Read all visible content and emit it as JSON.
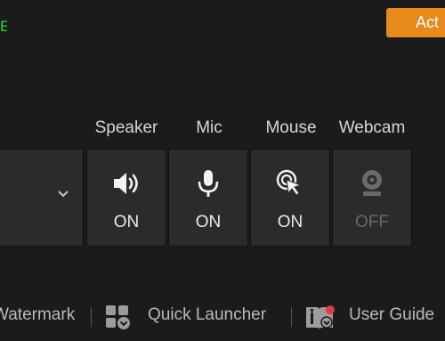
{
  "header": {
    "status_fragment": "E",
    "activate_label": "Act"
  },
  "devices": {
    "speaker": {
      "label": "Speaker",
      "state": "ON"
    },
    "mic": {
      "label": "Mic",
      "state": "ON"
    },
    "mouse": {
      "label": "Mouse",
      "state": "ON"
    },
    "webcam": {
      "label": "Webcam",
      "state": "OFF"
    }
  },
  "bottom_links": {
    "watermark": "Watermark",
    "quick_launcher": "Quick Launcher",
    "user_guide": "User Guide"
  },
  "icons": [
    "chevron-down-icon",
    "speaker-icon",
    "microphone-icon",
    "mouse-cursor-icon",
    "webcam-icon",
    "apps-grid-icon",
    "guide-book-icon"
  ],
  "colors": {
    "accent_orange": "#e8891c",
    "status_green": "#34d24a",
    "notification_red": "#e23b3b"
  }
}
